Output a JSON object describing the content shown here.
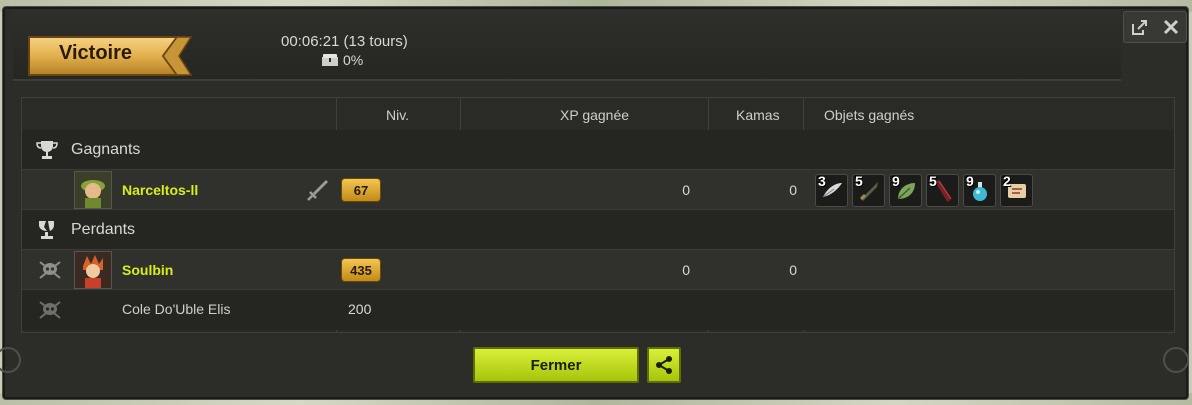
{
  "window": {
    "result_label": "Victoire",
    "duration": "00:06:21 (13 tours)",
    "loot_share": "0%"
  },
  "columns": {
    "level": "Niv.",
    "xp": "XP gagnée",
    "kamas": "Kamas",
    "items": "Objets gagnés"
  },
  "winners": {
    "label": "Gagnants",
    "players": [
      {
        "name": "Narceltos-ll",
        "level": "67",
        "xp": "0",
        "kamas": "0"
      }
    ],
    "items": [
      {
        "qty": "3",
        "icon": "feather-icon"
      },
      {
        "qty": "5",
        "icon": "dagger-icon"
      },
      {
        "qty": "9",
        "icon": "leaf-icon"
      },
      {
        "qty": "5",
        "icon": "red-staff-icon"
      },
      {
        "qty": "9",
        "icon": "potion-icon"
      },
      {
        "qty": "2",
        "icon": "scroll-icon"
      }
    ]
  },
  "losers": {
    "label": "Perdants",
    "players": [
      {
        "name": "Soulbin",
        "level": "435",
        "xp": "0",
        "kamas": "0"
      },
      {
        "name": "Cole Do'Uble Elis",
        "level": "200"
      }
    ]
  },
  "footer": {
    "close_label": "Fermer"
  },
  "colors": {
    "accent": "#c8e11b",
    "player_name": "#d7ee1a",
    "level_badge": "#e8b534",
    "panel_bg": "#2c2d29"
  }
}
